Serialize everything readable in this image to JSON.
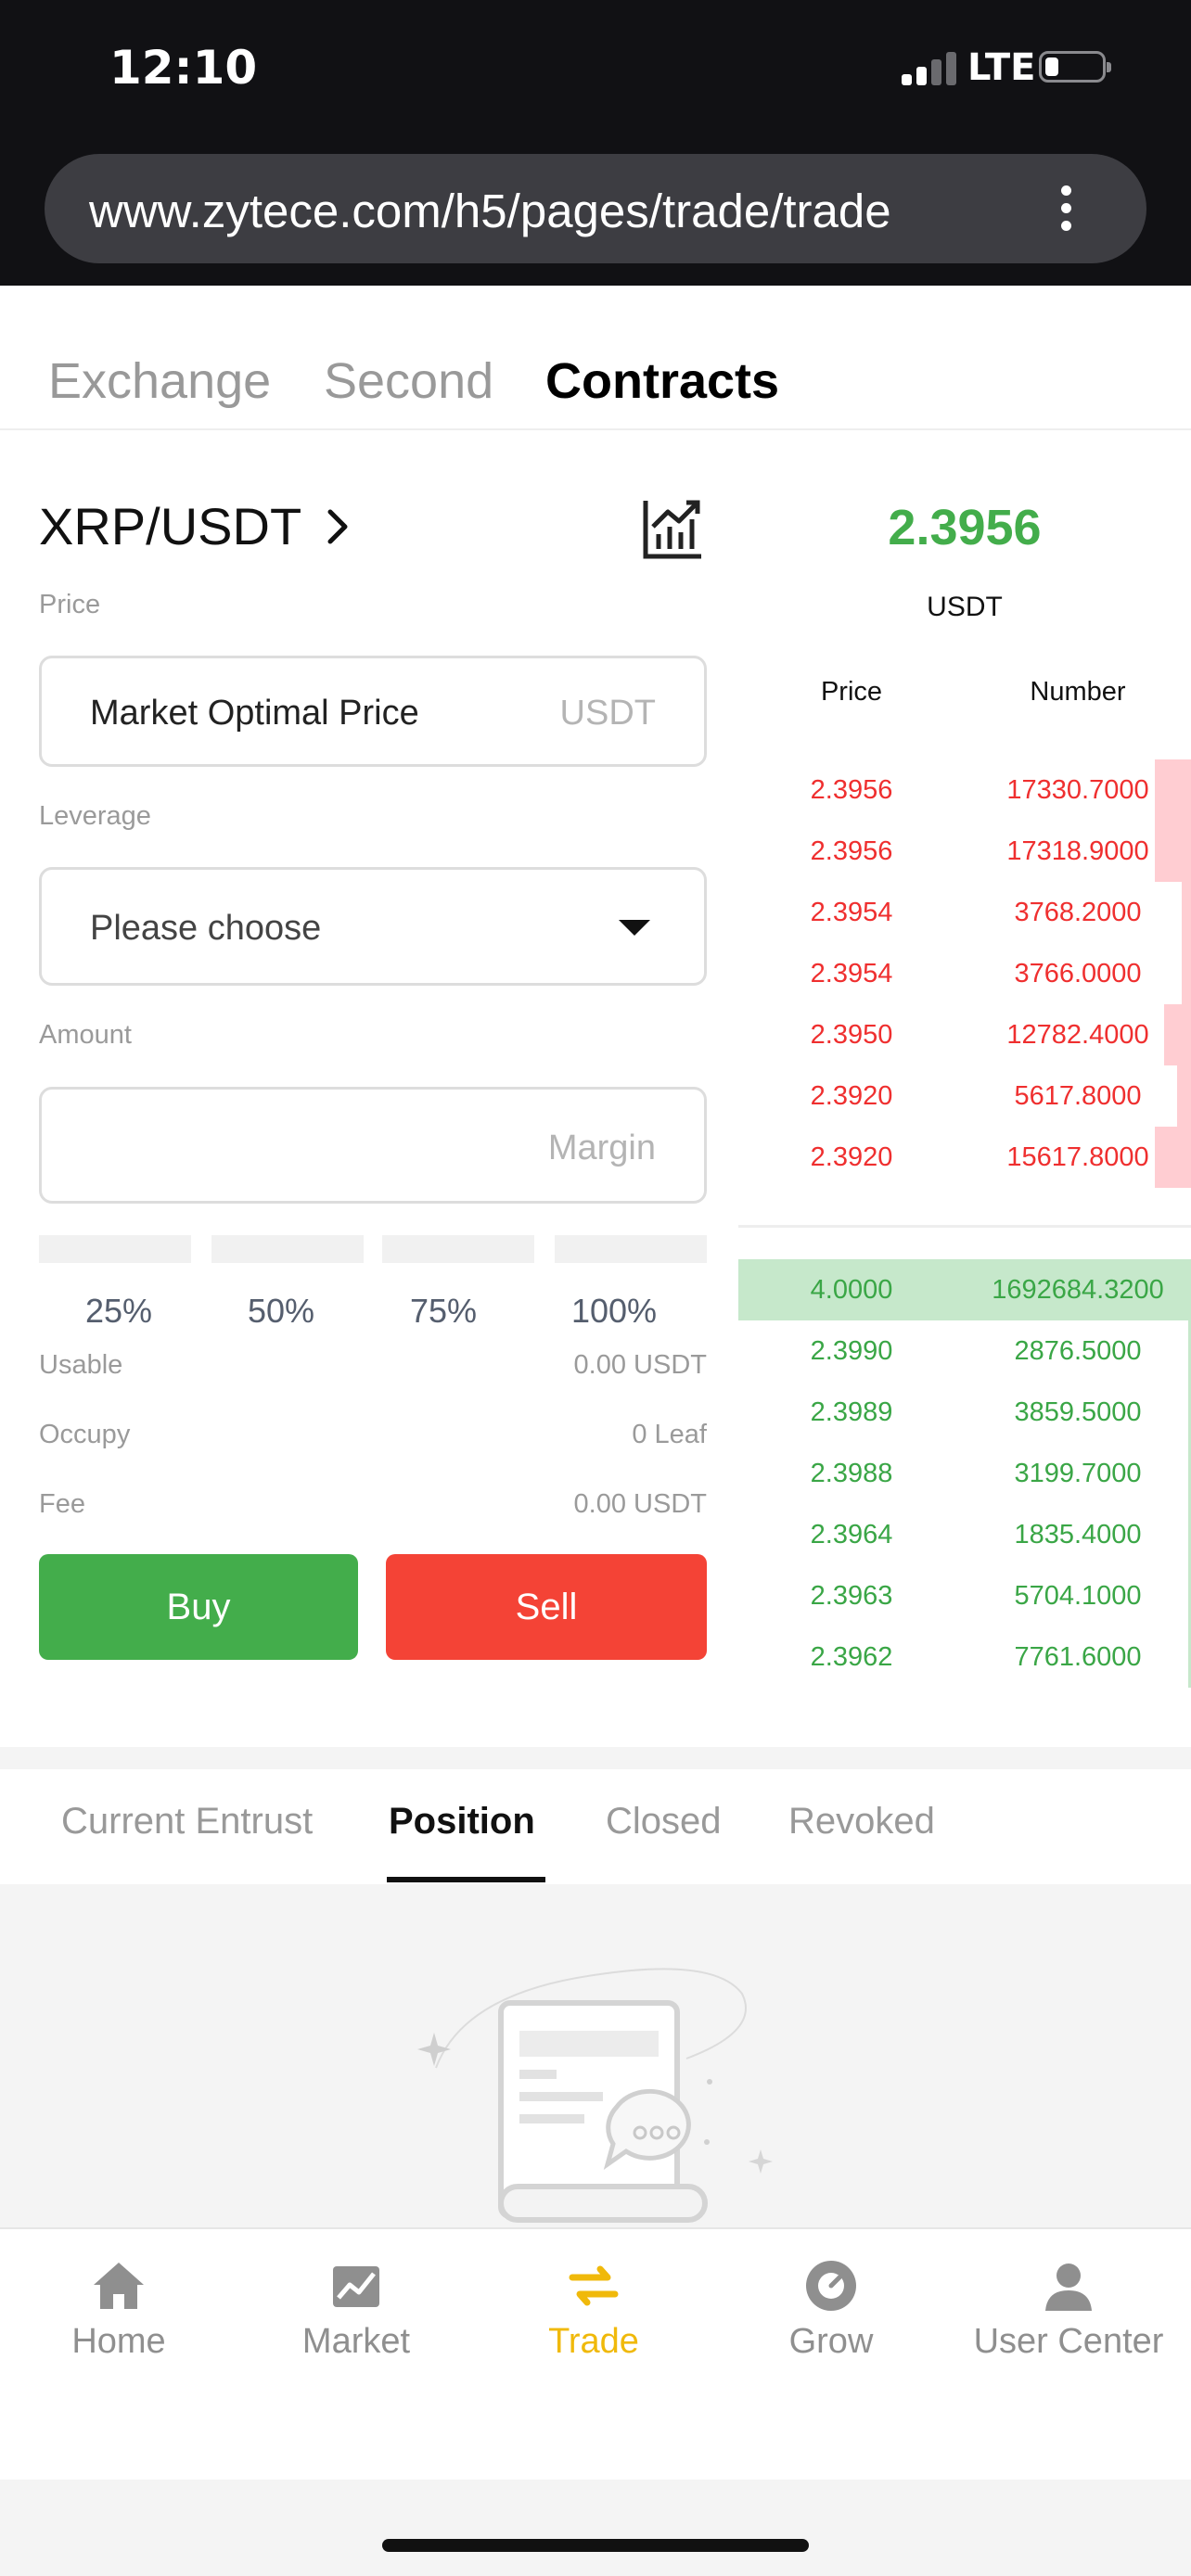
{
  "status": {
    "time": "12:10",
    "network": "LTE"
  },
  "browser": {
    "url": "www.zytece.com/h5/pages/trade/trade"
  },
  "tabs": [
    "Exchange",
    "Second",
    "Contracts"
  ],
  "form": {
    "pair": "XRP/USDT",
    "price_label": "Price",
    "price_value": "Market Optimal Price",
    "price_unit": "USDT",
    "leverage_label": "Leverage",
    "leverage_value": "Please choose",
    "amount_label": "Amount",
    "amount_placeholder": "Margin",
    "percentages": [
      "25%",
      "50%",
      "75%",
      "100%"
    ],
    "usable_label": "Usable",
    "usable_value": "0.00 USDT",
    "occupy_label": "Occupy",
    "occupy_value": "0 Leaf",
    "fee_label": "Fee",
    "fee_value": "0.00 USDT",
    "buy_label": "Buy",
    "sell_label": "Sell"
  },
  "orderbook": {
    "last_price": "2.3956",
    "unit": "USDT",
    "price_header": "Price",
    "number_header": "Number",
    "asks": [
      {
        "price": "2.3956",
        "number": "17330.7000",
        "depth": 0.08
      },
      {
        "price": "2.3956",
        "number": "17318.9000",
        "depth": 0.08
      },
      {
        "price": "2.3954",
        "number": "3768.2000",
        "depth": 0.02
      },
      {
        "price": "2.3954",
        "number": "3766.0000",
        "depth": 0.02
      },
      {
        "price": "2.3950",
        "number": "12782.4000",
        "depth": 0.06
      },
      {
        "price": "2.3920",
        "number": "5617.8000",
        "depth": 0.03
      },
      {
        "price": "2.3920",
        "number": "15617.8000",
        "depth": 0.08
      }
    ],
    "bids": [
      {
        "price": "4.0000",
        "number": "1692684.3200"
      },
      {
        "price": "2.3990",
        "number": "2876.5000"
      },
      {
        "price": "2.3989",
        "number": "3859.5000"
      },
      {
        "price": "2.3988",
        "number": "3199.7000"
      },
      {
        "price": "2.3964",
        "number": "1835.4000"
      },
      {
        "price": "2.3963",
        "number": "5704.1000"
      },
      {
        "price": "2.3962",
        "number": "7761.6000"
      }
    ]
  },
  "subtabs": [
    "Current Entrust",
    "Position",
    "Closed",
    "Revoked"
  ],
  "nav": [
    "Home",
    "Market",
    "Trade",
    "Grow",
    "User Center"
  ],
  "colors": {
    "buy": "#43ad4b",
    "sell": "#f44336",
    "accent": "#f0b90b"
  }
}
